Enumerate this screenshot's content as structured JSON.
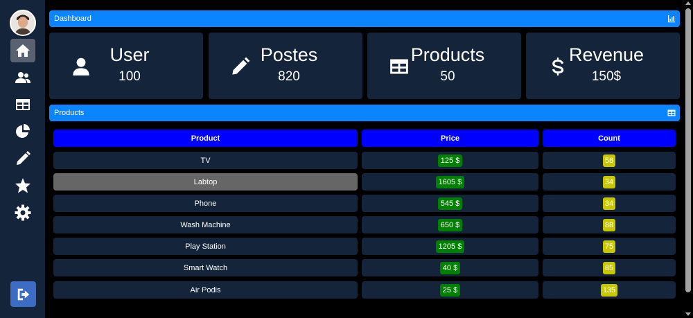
{
  "sidebar": {
    "items": [
      {
        "name": "home-icon",
        "active": true
      },
      {
        "name": "users-icon",
        "active": false
      },
      {
        "name": "table-icon",
        "active": false
      },
      {
        "name": "chart-pie-icon",
        "active": false
      },
      {
        "name": "pencil-icon",
        "active": false
      },
      {
        "name": "star-icon",
        "active": false
      },
      {
        "name": "gear-icon",
        "active": false
      }
    ],
    "logout_icon": "logout-icon"
  },
  "dashboard": {
    "title": "Dashboard",
    "icon": "chart-bar-icon"
  },
  "cards": [
    {
      "title": "User",
      "value": "100",
      "icon": "user-icon"
    },
    {
      "title": "Postes",
      "value": "820",
      "icon": "pencil-icon"
    },
    {
      "title": "Products",
      "value": "50",
      "icon": "table-icon"
    },
    {
      "title": "Revenue",
      "value": "150$",
      "icon": "dollar-icon"
    }
  ],
  "products": {
    "title": "Products",
    "icon": "table-icon",
    "columns": [
      "Product",
      "Price",
      "Count"
    ],
    "rows": [
      {
        "product": "TV",
        "price": "125 $",
        "count": "58"
      },
      {
        "product": "Labtop",
        "price": "1605 $",
        "count": "34",
        "selected": true
      },
      {
        "product": "Phone",
        "price": "545 $",
        "count": "34"
      },
      {
        "product": "Wash Machine",
        "price": "650 $",
        "count": "88"
      },
      {
        "product": "Play Station",
        "price": "1205 $",
        "count": "75"
      },
      {
        "product": "Smart Watch",
        "price": "40 $",
        "count": "85"
      },
      {
        "product": "Air Podis",
        "price": "25 $",
        "count": "135"
      }
    ]
  },
  "colors": {
    "header": "#0a84ff",
    "table_header": "#0000ff",
    "price_badge": "#008000",
    "count_badge": "#c8c800",
    "panel": "#14243b"
  }
}
